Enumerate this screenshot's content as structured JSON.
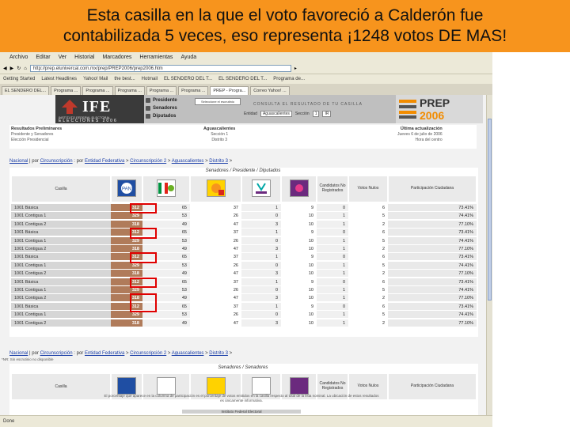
{
  "banner": {
    "line1": "Esta casilla en la que el voto favoreció a Calderón fue",
    "line2": "contabilizada 5 veces, eso representa ¡1248 votos DE MAS!"
  },
  "browser": {
    "menu": [
      "Archivo",
      "Editar",
      "Ver",
      "Historial",
      "Marcadores",
      "Herramientas",
      "Ayuda"
    ],
    "address": "http://prep.elunivercal.com.mx/prep/PREP2006/prep2006.htm",
    "bookmarks": [
      "Getting Started",
      "Latest Headlines",
      "Yahoo! Mail",
      "the best...",
      "Hotmail",
      "EL SENDERO DEL T...",
      "EL SENDERO DEL T...",
      "Programa de..."
    ],
    "tabs": [
      "EL SENDERO DEL...",
      "Programa ...",
      "Programa ...",
      "Programa ...",
      "Programa ...",
      "Programa ...",
      "PREP - Progra...",
      "Correo Yahoo! ..."
    ],
    "status": "Done"
  },
  "ife": {
    "logo": "IFE",
    "logo_sub": "INSTITUTO FEDERAL ELECTORAL",
    "logo_year": "ELECCIONES 2006",
    "nav": [
      "Presidente",
      "Senadores",
      "Diputados"
    ],
    "consult_button": "Seleccione el escrutinio",
    "consult_title": "CONSULTA EL RESULTADO DE TU CASILLA",
    "filter_entity_label": "Entidad",
    "filter_entity_value": "Aguascalientes",
    "filter_section_label": "Sección",
    "filter_section_value": "1",
    "filter_go": "IR",
    "prep_word": "PREP",
    "prep_year": "2006"
  },
  "info": {
    "left_title": "Resultados Preliminares",
    "left_l1": "Presidente y Senadores",
    "left_l2": "Elección Presidencial",
    "mid_title": "Aguascalientes",
    "mid_l1": "Sección 1",
    "mid_l2": "Distrito 3",
    "right_title": "Última actualización",
    "right_l1": "Jueves 6 de julio de 2006",
    "right_l2": "Hora del centro"
  },
  "crumb1": {
    "nacional": "Nacional",
    "t1": " | por ",
    "circ": "Circunscripción",
    "t2": " : por ",
    "ent": "Entidad Federativa",
    "t3": " > ",
    "circ2": "Circunscripción 2",
    "t4": " > ",
    "ags": "Aguascalientes",
    "t5": " > ",
    "dist": "Distrito 3",
    "t6": " >"
  },
  "crumb2": {
    "nacional": "Nacional",
    "t1": " | por ",
    "circ": "Circunscripción",
    "t2": " : por ",
    "ent": "Entidad Federativa",
    "t3": " > ",
    "circ2": "Circunscripción 2",
    "t4": " > ",
    "ags": "Aguascalientes",
    "t5": " > ",
    "dist": "Distrito 3",
    "t6": " >"
  },
  "results": {
    "title": "Senadores / Presidente / Diputados",
    "col_casilla": "Casilla",
    "col_no_reg": "Candidatos No Registrados",
    "col_nulos": "Votos Nulos",
    "col_participacion": "Participación Ciudadana",
    "rows": [
      {
        "casilla": "1001 Básica",
        "v": [
          "312",
          "65",
          "37",
          "1",
          "9",
          "0",
          "6"
        ],
        "p": "73.41%"
      },
      {
        "casilla": "1001 Contigua 1",
        "v": [
          "329",
          "53",
          "26",
          "0",
          "10",
          "1",
          "5"
        ],
        "p": "74.41%"
      },
      {
        "casilla": "1001 Contigua 2",
        "v": [
          "318",
          "49",
          "47",
          "3",
          "10",
          "1",
          "2"
        ],
        "p": "77.10%"
      },
      {
        "casilla": "1001 Básica",
        "v": [
          "312",
          "65",
          "37",
          "1",
          "9",
          "0",
          "6"
        ],
        "p": "73.41%"
      },
      {
        "casilla": "1001 Contigua 1",
        "v": [
          "329",
          "53",
          "26",
          "0",
          "10",
          "1",
          "5"
        ],
        "p": "74.41%"
      },
      {
        "casilla": "1001 Contigua 2",
        "v": [
          "318",
          "49",
          "47",
          "3",
          "10",
          "1",
          "2"
        ],
        "p": "77.10%"
      },
      {
        "casilla": "1001 Básica",
        "v": [
          "312",
          "65",
          "37",
          "1",
          "9",
          "0",
          "6"
        ],
        "p": "73.41%"
      },
      {
        "casilla": "1001 Contigua 1",
        "v": [
          "329",
          "53",
          "26",
          "0",
          "10",
          "1",
          "5"
        ],
        "p": "74.41%"
      },
      {
        "casilla": "1001 Contigua 2",
        "v": [
          "318",
          "49",
          "47",
          "3",
          "10",
          "1",
          "2"
        ],
        "p": "77.10%"
      },
      {
        "casilla": "1001 Básica",
        "v": [
          "312",
          "65",
          "37",
          "1",
          "9",
          "0",
          "6"
        ],
        "p": "73.41%"
      },
      {
        "casilla": "1001 Contigua 1",
        "v": [
          "329",
          "53",
          "26",
          "0",
          "10",
          "1",
          "5"
        ],
        "p": "74.41%"
      },
      {
        "casilla": "1001 Contigua 2",
        "v": [
          "318",
          "49",
          "47",
          "3",
          "10",
          "1",
          "2"
        ],
        "p": "77.10%"
      },
      {
        "casilla": "1001 Básica",
        "v": [
          "312",
          "65",
          "37",
          "1",
          "9",
          "0",
          "6"
        ],
        "p": "73.41%"
      },
      {
        "casilla": "1001 Contigua 1",
        "v": [
          "329",
          "53",
          "26",
          "0",
          "10",
          "1",
          "5"
        ],
        "p": "74.41%"
      },
      {
        "casilla": "1001 Contigua 2",
        "v": [
          "318",
          "49",
          "47",
          "3",
          "10",
          "1",
          "2"
        ],
        "p": "77.10%"
      }
    ],
    "note": "*NR: Sin escrutinio no disponible"
  },
  "senate": {
    "title": "Senadores / Senadores",
    "col_casilla": "Casilla",
    "col_no_reg": "Candidatos No Registrados",
    "col_nulos": "Votos Nulos",
    "col_participacion": "Participación Ciudadana",
    "footer_text": "El porcentaje que aparece en la columna de participación es el porcentaje de votos emitidos en la casilla respecto al total de la lista nominal. La ubicación de estos resultados es únicamente informativa.",
    "footer_ife": "Instituto Federal Electoral"
  },
  "colors": {
    "banner": "#f7941d",
    "highlight": "#e00000",
    "pan_cell": "#b07b5a"
  },
  "parties": [
    "PAN",
    "PRI-PVEM",
    "PRD-PT-Conv",
    "Nueva Alianza",
    "Alternativa"
  ]
}
